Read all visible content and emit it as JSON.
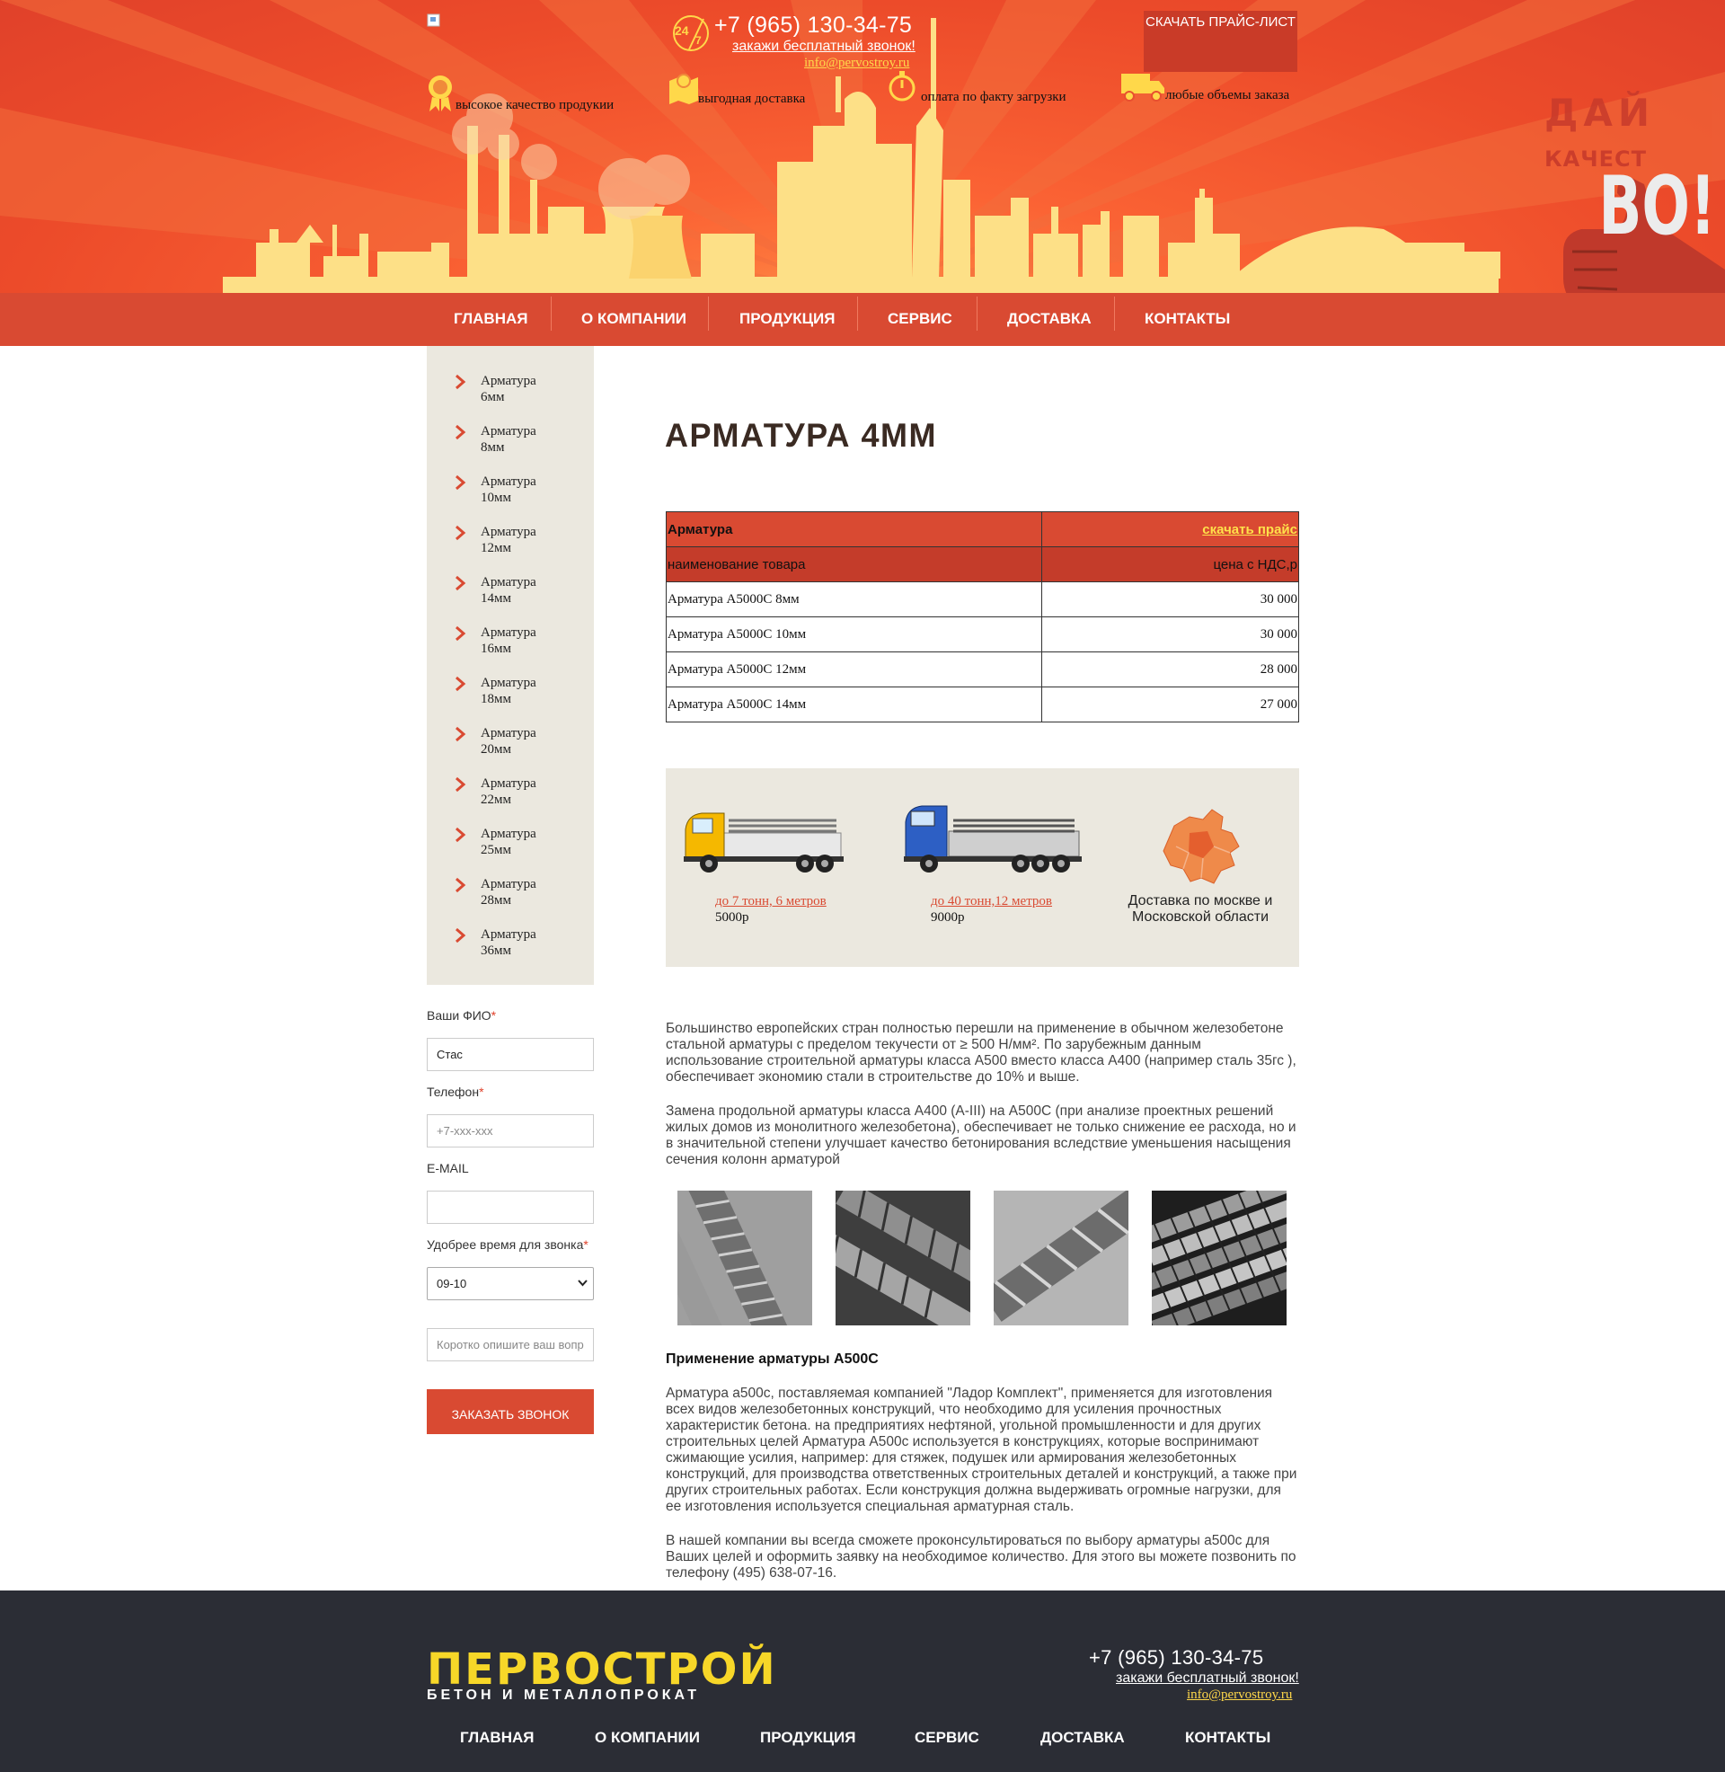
{
  "header": {
    "phone": "+7 (965) 130-34-75",
    "callback_link": "закажи бесплатный звонок!",
    "email": "info@pervostroy.ru",
    "price_list_button": "СКАЧАТЬ ПРАЙС-ЛИСТ",
    "features": [
      {
        "icon": "medal-icon",
        "label": "высокое качество продукии"
      },
      {
        "icon": "map-pin-icon",
        "label": "выгодная доставка"
      },
      {
        "icon": "stopwatch-icon",
        "label": "оплата по факту загрузки"
      },
      {
        "icon": "truck-icon",
        "label": "любые объемы заказа"
      }
    ],
    "badge_24": "24",
    "badge_7": "7",
    "slogan": {
      "line1": "ДАЙ",
      "line2": "КАЧЕСТ",
      "line3": "ВО!"
    }
  },
  "nav": {
    "items": [
      "ГЛАВНАЯ",
      "О КОМПАНИИ",
      "ПРОДУКЦИЯ",
      "СЕРВИС",
      "ДОСТАВКА",
      "КОНТАКТЫ"
    ]
  },
  "sidebar": {
    "items": [
      {
        "label": "Арматура 6мм"
      },
      {
        "label": "Арматура 8мм"
      },
      {
        "label": "Арматура 10мм"
      },
      {
        "label": "Арматура 12мм"
      },
      {
        "label": "Арматура 14мм"
      },
      {
        "label": "Арматура 16мм"
      },
      {
        "label": "Арматура 18мм"
      },
      {
        "label": "Арматура 20мм"
      },
      {
        "label": "Арматура 22мм"
      },
      {
        "label": "Арматура 25мм"
      },
      {
        "label": "Арматура 28мм"
      },
      {
        "label": "Арматура 36мм"
      }
    ]
  },
  "form": {
    "name_label": "Ваши ФИО",
    "name_value": "Стас",
    "phone_label": "Телефон",
    "phone_placeholder": "+7-xxx-xxx",
    "email_label": "E-MAIL",
    "time_label": "Удобрее время для звонка",
    "time_value": "09-10",
    "question_placeholder": "Коротко опишите ваш вопрос",
    "required_mark": "*",
    "submit_label": "ЗАКАЗАТЬ ЗВОНОК"
  },
  "main": {
    "title": "АРМАТУРА 4ММ",
    "table": {
      "header_title": "Арматура",
      "header_link": "скачать прайс",
      "col_name": "наименование товара",
      "col_price": "цена с НДС,р",
      "rows": [
        {
          "name": "Арматура А5000С 8мм",
          "price": "30 000"
        },
        {
          "name": "Арматура А5000С 10мм",
          "price": "30 000"
        },
        {
          "name": "Арматура А5000С 12мм",
          "price": "28 000"
        },
        {
          "name": "Арматура А5000С 14мм",
          "price": "27 000"
        }
      ]
    },
    "delivery": {
      "small_truck_link": "до 7 тонн, 6 метров",
      "small_truck_price": "5000р",
      "big_truck_link": "до 40 тонн,12 метров",
      "big_truck_price": "9000р",
      "region_note": "Доставка по москве и Московской области"
    },
    "paragraph1": "Большинство европейских стран полностью перешли на применение в обычном железобетоне стальной арматуры с пределом текучести от ≥ 500 Н/мм². По зарубежным данным использование строительной арматуры класса А500 вместо класса А400 (например сталь 35гс ), обеспечивает экономию стали в строительстве до 10% и выше.",
    "paragraph2": "Замена продольной арматуры класса А400 (А-III) на А500С (при анализе проектных решений жилых домов из монолитного железобетона), обеспечивает не только снижение ее расхода, но и в значительной степени улучшает качество бетонирования вследствие уменьшения насыщения сечения колонн арматурой",
    "section_heading": "Применение арматуры А500С",
    "paragraph3": "Арматура а500с, поставляемая компанией \"Ладор Комплект\", применяется для изготовления всех видов железобетонных конструкций, что необходимо для усиления прочностных характеристик бетона. на предприятиях нефтяной, угольной промышленности и для других строительных целей Арматура А500с используется в конструкциях, которые воспринимают сжимающие усилия, например: для стяжек, подушек или армирования железобетонных конструкций, для производства ответственных строительных деталей и конструкций, а также при других строительных работах. Если конструкция должна выдерживать огромные нагрузки, для ее изготовления используется специальная арматурная сталь.",
    "paragraph4": "В нашей компании вы всегда сможете проконсультироваться по выбору арматуры а500с для Ваших целей и оформить заявку на необходимое количество. Для этого вы можете позвонить по телефону (495) 638-07-16."
  },
  "footer": {
    "logo_main": "ПЕРВОСТРОЙ",
    "logo_sub": "БЕТОН И МЕТАЛЛОПРОКАТ",
    "phone": "+7 (965) 130-34-75",
    "callback_link": "закажи бесплатный звонок!",
    "email": "info@pervostroy.ru",
    "nav": [
      "ГЛАВНАЯ",
      "О КОМПАНИИ",
      "ПРОДУКЦИЯ",
      "СЕРВИС",
      "ДОСТАВКА",
      "КОНТАКТЫ"
    ]
  },
  "colors": {
    "accent": "#d94a32",
    "header_orange": "#f2592f",
    "sidebar_bg": "#ebe8df",
    "footer_bg": "#2b2d35",
    "logo_yellow": "#f7d728",
    "link_yellow": "#ffe14a"
  }
}
